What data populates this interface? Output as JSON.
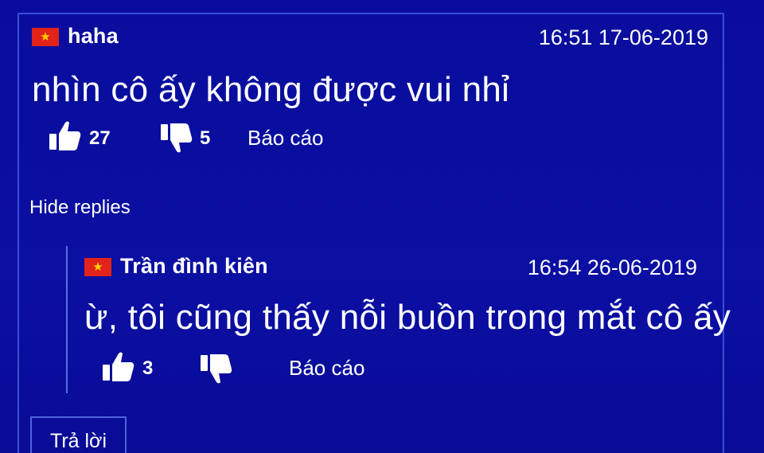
{
  "comment": {
    "username": "haha",
    "timestamp": "16:51 17-06-2019",
    "text": "nhìn cô ấy không được vui nhỉ",
    "likes": "27",
    "dislikes": "5",
    "report_label": "Báo cáo"
  },
  "hide_replies_label": "Hide replies",
  "reply": {
    "username": "Trần đình kiên",
    "timestamp": "16:54 26-06-2019",
    "text": "ừ, tôi cũng thấy nỗi buồn trong mắt cô ấy",
    "likes": "3",
    "report_label": "Báo cáo"
  },
  "reply_button_label": "Trả lời",
  "icons": {
    "flag": "vietnam-flag-icon",
    "like": "thumbs-up-icon",
    "dislike": "thumbs-down-icon"
  },
  "colors": {
    "background": "#0a0d9c",
    "border": "#3a4fd6",
    "text": "#ffffff",
    "flag_red": "#e2231a",
    "flag_star": "#ffd300"
  }
}
